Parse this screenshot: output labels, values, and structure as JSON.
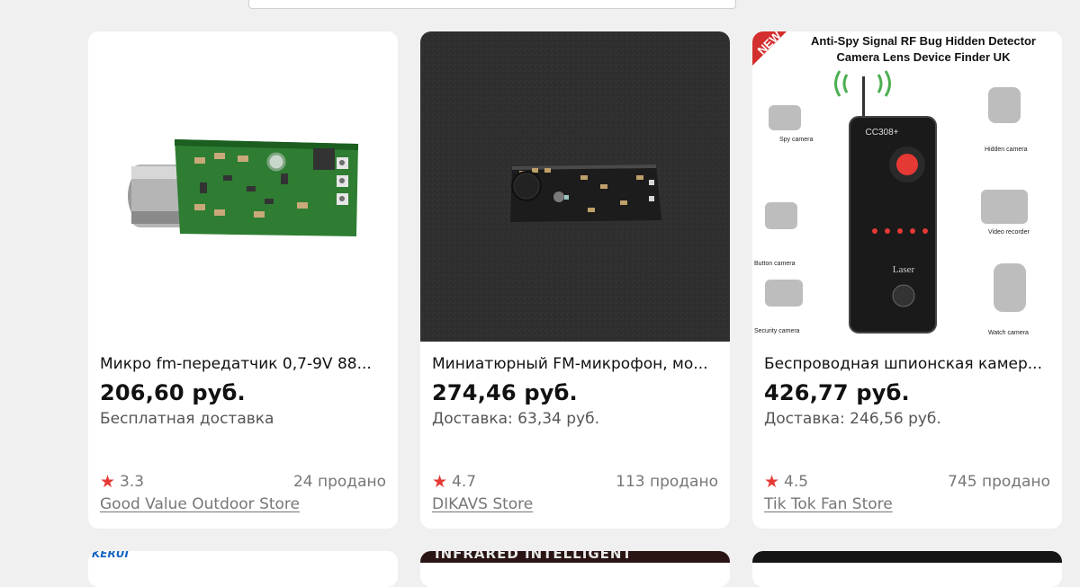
{
  "products": [
    {
      "title": "Микро fm-передатчик 0,7-9V 88...",
      "price": "206,60 руб.",
      "shipping": "Бесплатная доставка",
      "rating": "3.3",
      "sold": "24 продано",
      "store": "Good Value Outdoor Store",
      "image": "green-pcb-module-image"
    },
    {
      "title": "Миниатюрный FM-микрофон, мо...",
      "price": "274,46 руб.",
      "shipping": "Доставка: 63,34 руб.",
      "rating": "4.7",
      "sold": "113 продано",
      "store": "DIKAVS Store",
      "image": "black-pcb-on-dark-background-image"
    },
    {
      "title": "Беспроводная шпионская камер...",
      "price": "426,77 руб.",
      "shipping": "Доставка: 246,56 руб.",
      "rating": "4.5",
      "sold": "745 продано",
      "store": "Tik Tok Fan Store",
      "image": "rf-detector-infographic-image",
      "image_text": {
        "badge": "NEW",
        "heading_line1": "Anti-Spy Signal RF Bug Hidden Detector",
        "heading_line2": "Camera Lens Device Finder UK",
        "device_model": "CC308+",
        "device_label": "Laser",
        "labels": [
          "Spy camera",
          "Hidden camera",
          "Button camera",
          "Video recorder",
          "Security camera",
          "Watch camera"
        ]
      }
    }
  ],
  "next_row_text": "INFRARED INTELLIGENT",
  "next_row_logo": "KERUI"
}
